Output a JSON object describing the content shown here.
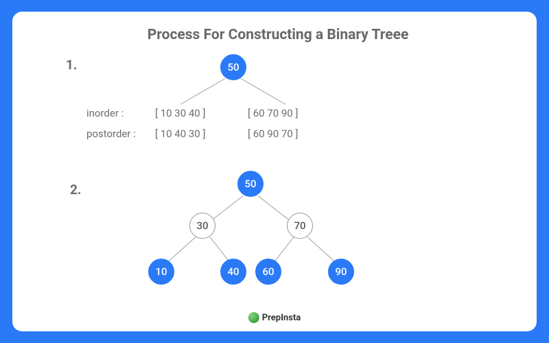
{
  "title": "Process For Constructing a Binary Treee",
  "steps": {
    "one": "1.",
    "two": "2."
  },
  "traversal": {
    "inorder_label": "inorder :",
    "inorder_left": "[ 10 30 40 ]",
    "inorder_right": "[ 60 70 90 ]",
    "postorder_label": "postorder :",
    "postorder_left": "[ 10 40 30 ]",
    "postorder_right": "[ 60 90 70 ]"
  },
  "tree1": {
    "root": "50"
  },
  "tree2": {
    "root": "50",
    "left": "30",
    "right": "70",
    "ll": "10",
    "lr": "40",
    "rl": "60",
    "rr": "90"
  },
  "logo": {
    "text": "PrepInsta"
  },
  "colors": {
    "accent": "#2a7af7"
  }
}
